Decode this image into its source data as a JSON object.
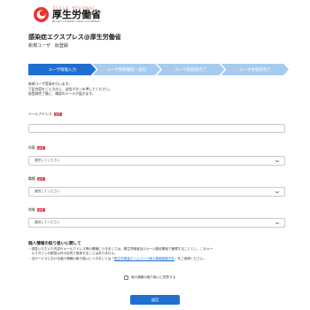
{
  "header": {
    "logo_tagline": "さしえしえ、やさいさの人に",
    "logo_name": "厚生労働省",
    "logo_en": "Ministry of Health, Labour and Welfare"
  },
  "page": {
    "title": "感染症エクスプレス@厚生労働省",
    "subtitle": "新規ユーザ　仮登録"
  },
  "steps": [
    {
      "label": "ユーザ情報入力",
      "state": "active"
    },
    {
      "label": "ユーザ情報確認・送信",
      "state": "inactive"
    },
    {
      "label": "ユーザ仮登録完了",
      "state": "inactive"
    },
    {
      "label": "ユーザ本登録完了",
      "state": "inactive"
    }
  ],
  "intro": {
    "line1": "新規ユーザ登録を行います。",
    "line2": "下記内容をご入力の上、送信ボタンを押してください。",
    "line3": "仮登録完了後に、確認のメールが届きます。"
  },
  "form": {
    "required_badge": "必須",
    "email": {
      "label": "メールアドレス",
      "value": ""
    },
    "field2": {
      "label": "所属",
      "placeholder": "選択してください"
    },
    "field3": {
      "label": "職種",
      "placeholder": "選択してください"
    },
    "field4": {
      "label": "地域",
      "placeholder": "選択してください"
    }
  },
  "privacy": {
    "title": "個人情報の取り扱いに関して",
    "line1": "・回答いただいた内容やメールアドレス等の情報につきましては、厚生労働省及びメール配信業者で管理することとし、このメー",
    "line2": "　ルマガジンの配信以外の目的で使用することはありません。",
    "line3_prefix": "・当サービスにおける個人情報の取り扱いにつきましては「",
    "link": "厚生労働省ホームページ個人情報保護方針",
    "line3_suffix": "」をご参照ください。",
    "agree_label": "個人情報の取り扱いに同意する",
    "agreed": false
  },
  "submit_label": "送信",
  "colors": {
    "primary": "#1f6fd1",
    "step_inactive": "#a7cbee",
    "required": "#e0394b"
  }
}
